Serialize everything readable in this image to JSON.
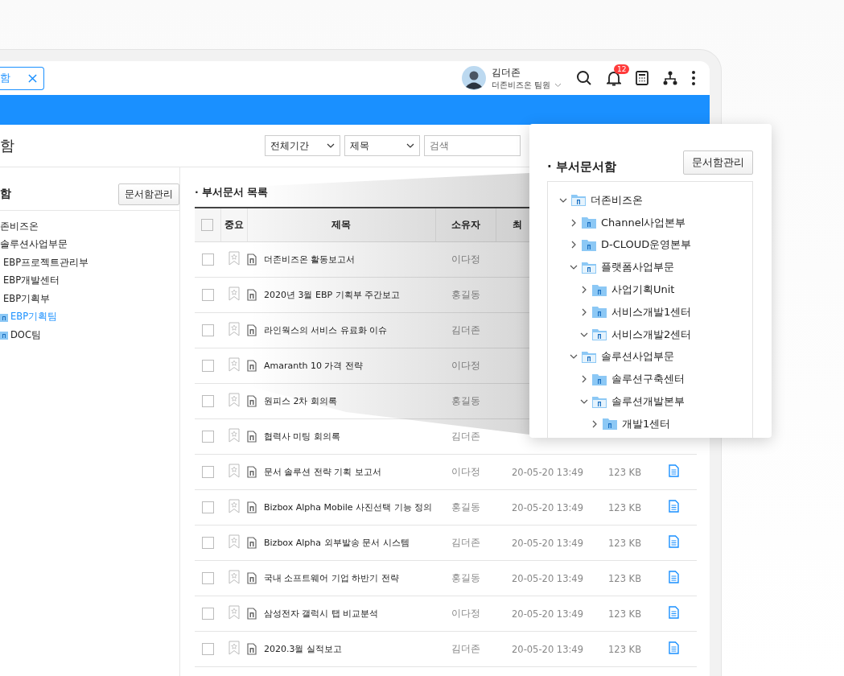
{
  "tab": {
    "label": "함"
  },
  "user": {
    "name": "김더존",
    "role": "더존비즈온 팀원"
  },
  "notifications": {
    "count": "12"
  },
  "page_title": "함",
  "filters": {
    "period": "전체기간",
    "field": "제목",
    "search_placeholder": "검색"
  },
  "sidebar": {
    "title": "함",
    "manage_button": "문서함관리",
    "tree": [
      {
        "label": "존비즈온",
        "selected": false,
        "children": [
          {
            "label": "솔루션사업부문",
            "selected": false,
            "children": [
              {
                "label": "EBP프로젝트관리부",
                "selected": false
              },
              {
                "label": "EBP개발센터",
                "selected": false
              },
              {
                "label": "EBP기획부",
                "selected": false,
                "children": [
                  {
                    "label": "EBP기획팀",
                    "selected": true
                  },
                  {
                    "label": "DOC팀",
                    "selected": false
                  }
                ]
              }
            ]
          }
        ]
      }
    ]
  },
  "list": {
    "title": "· 부서문서 목록",
    "all_checked": false,
    "columns": [
      "중요",
      "제목",
      "소유자",
      "최"
    ],
    "rows": [
      {
        "checked": false,
        "important": false,
        "title": "더존비즈온 활동보고서",
        "owner": "이다정"
      },
      {
        "checked": false,
        "important": false,
        "title": "2020년 3월 EBP 기획부 주간보고",
        "owner": "홍길동"
      },
      {
        "checked": false,
        "important": false,
        "title": "라인웍스의 서비스 유료화 이슈",
        "owner": "김더존"
      },
      {
        "checked": false,
        "important": false,
        "title": "Amaranth 10 가격 전략",
        "owner": "이다정"
      },
      {
        "checked": false,
        "important": false,
        "title": "원피스 2차 회의록",
        "owner": "홍길동"
      },
      {
        "checked": false,
        "important": false,
        "title": "협력사 미팅 회의록",
        "owner": "김더존"
      },
      {
        "checked": false,
        "important": false,
        "title": "문서 솔루션 전략 기획 보고서",
        "owner": "이다정",
        "date": "20-05-20 13:49",
        "size": "123 KB",
        "file": true
      },
      {
        "checked": false,
        "important": false,
        "title": "Bizbox Alpha Mobile 사진선택 기능 정의",
        "owner": "홍길동",
        "date": "20-05-20 13:49",
        "size": "123 KB",
        "file": true
      },
      {
        "checked": false,
        "important": false,
        "title": "Bizbox Alpha 외부발송 문서 시스템",
        "owner": "김더존",
        "date": "20-05-20 13:49",
        "size": "123 KB",
        "file": true
      },
      {
        "checked": false,
        "important": false,
        "title": "국내 소프트웨어 기업 하반기 전략",
        "owner": "홍길동",
        "date": "20-05-20 13:49",
        "size": "123 KB",
        "file": true
      },
      {
        "checked": false,
        "important": false,
        "title": "삼성전자 갤럭시 탭 비교분석",
        "owner": "이다정",
        "date": "20-05-20 13:49",
        "size": "123 KB",
        "file": true
      },
      {
        "checked": false,
        "important": false,
        "title": "2020.3월 실적보고",
        "owner": "김더존",
        "date": "20-05-20 13:49",
        "size": "123 KB",
        "file": true
      }
    ]
  },
  "callout": {
    "title": "· 부서문서함",
    "manage_button": "문서함관리",
    "tree": [
      {
        "label": "더존비즈온",
        "expanded": true,
        "children": [
          {
            "label": "Channel사업본부",
            "expanded": false
          },
          {
            "label": "D-CLOUD운영본부",
            "expanded": false
          },
          {
            "label": "플랫폼사업부문",
            "expanded": true,
            "children": [
              {
                "label": "사업기획Unit",
                "expanded": false
              },
              {
                "label": "서비스개발1센터",
                "expanded": false
              },
              {
                "label": "서비스개발2센터",
                "expanded": true
              }
            ]
          },
          {
            "label": "솔루션사업부문",
            "expanded": true,
            "children": [
              {
                "label": "솔루션구축센터",
                "expanded": false
              },
              {
                "label": "솔루션개발본부",
                "expanded": true,
                "children": [
                  {
                    "label": "개발1센터",
                    "expanded": false
                  }
                ]
              }
            ]
          }
        ]
      }
    ]
  }
}
